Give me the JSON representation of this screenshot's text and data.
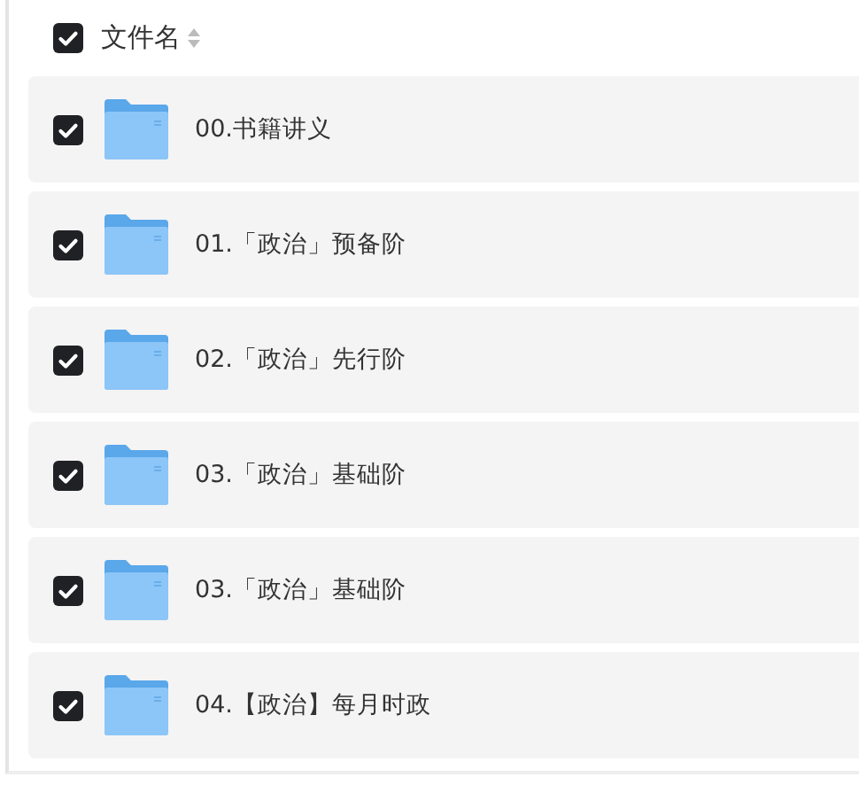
{
  "header": {
    "checked": true,
    "label": "文件名"
  },
  "files": [
    {
      "name": "00.书籍讲义",
      "checked": true
    },
    {
      "name": "01.「政治」预备阶",
      "checked": true
    },
    {
      "name": "02.「政治」先行阶",
      "checked": true
    },
    {
      "name": "03.「政治」基础阶",
      "checked": true
    },
    {
      "name": "03.「政治」基础阶",
      "checked": true
    },
    {
      "name": "04.【政治】每月时政",
      "checked": true
    }
  ]
}
